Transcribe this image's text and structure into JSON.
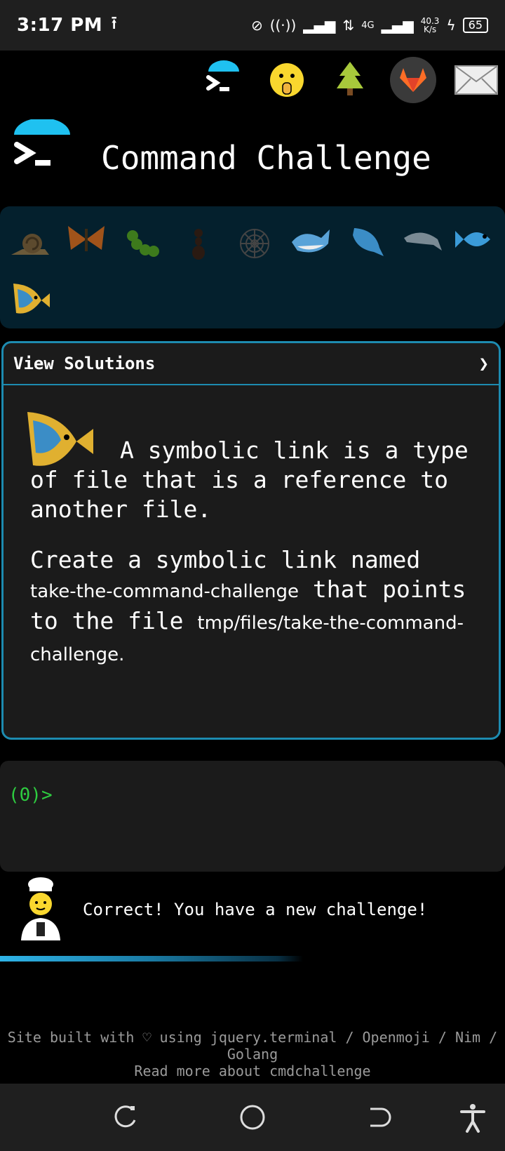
{
  "status_bar": {
    "time": "3:17 PM",
    "network": "4G",
    "speed_value": "40.3",
    "speed_unit": "K/s",
    "battery": "65"
  },
  "top_icons": [
    "terminal-icon",
    "shushing-face-icon",
    "christmas-tree-icon",
    "gitlab-icon",
    "envelope-icon"
  ],
  "header": {
    "title": "Command Challenge"
  },
  "badges": [
    "snail-icon",
    "butterfly-icon",
    "caterpillar-icon",
    "ant-icon",
    "spider-web-icon",
    "whale-icon",
    "whale2-icon",
    "dolphin-icon",
    "fish-icon",
    "tropical-fish-icon"
  ],
  "card": {
    "header_label": "View Solutions",
    "chevron": "❯",
    "para1": "A symbolic link is a type of file that is a reference to another file.",
    "para2_prefix": "Create a symbolic link named",
    "link_name": "take-the-command-challenge",
    "para2_mid": "that points to the file",
    "target_path": "tmp/files/take-the-command-challenge",
    "para2_end": "."
  },
  "terminal": {
    "prompt": "(0)>"
  },
  "message": {
    "text": "Correct! You have a new challenge!"
  },
  "footer": {
    "line1": "Site built with ♡ using jquery.terminal / Openmoji / Nim / Golang",
    "line2": "Read more about cmdchallenge"
  },
  "colors": {
    "accent": "#1d8bb0",
    "badge_bg": "#04202d",
    "prompt": "#2ecc40"
  }
}
